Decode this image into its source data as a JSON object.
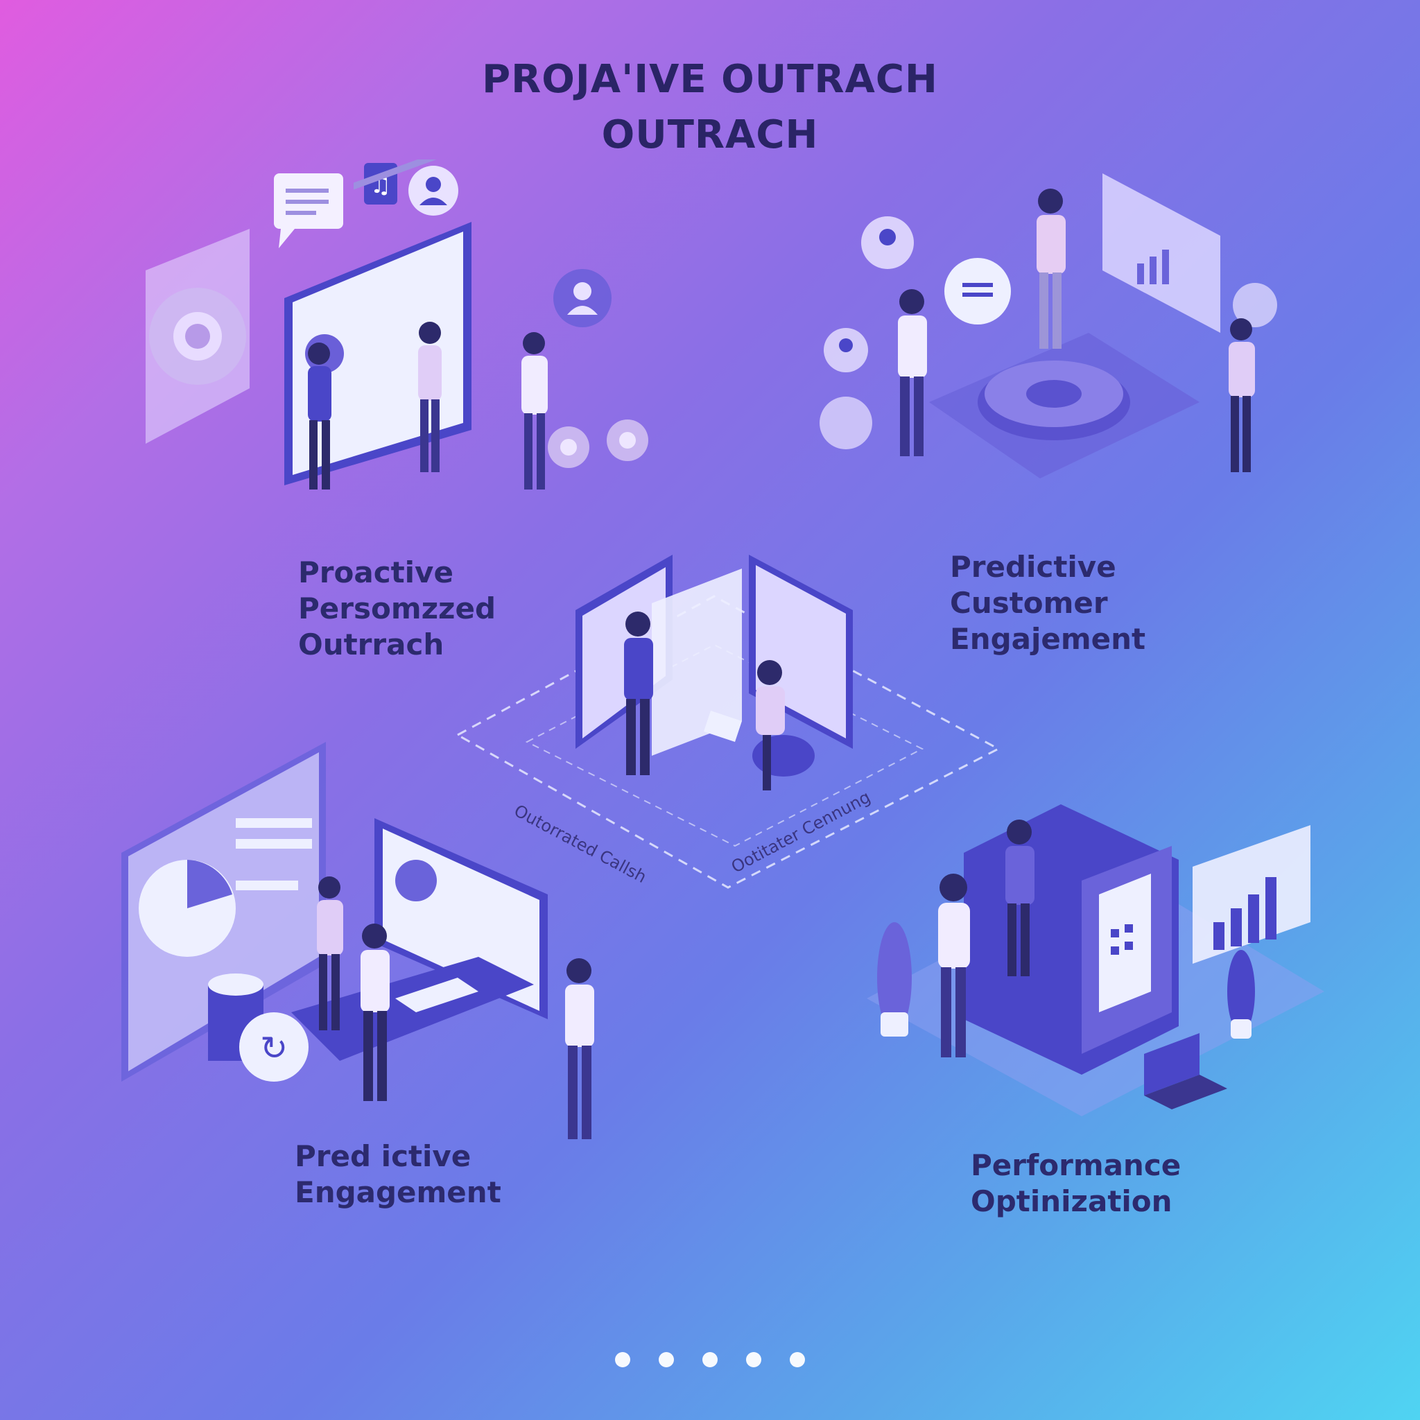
{
  "header": {
    "title_line1": "PROJA'IVE OUTRACH",
    "title_line2": "OUTRACH"
  },
  "sections": {
    "top_left": {
      "line1": "Proactive",
      "line2": "Persomzzed",
      "line3": "Outrrach"
    },
    "top_right": {
      "line1": "Predictive",
      "line2": "Customer",
      "line3": "Engajement"
    },
    "bottom_left": {
      "line1": "Pred ictive",
      "line2": "Engagement"
    },
    "bottom_right": {
      "line1": "Performance",
      "line2": "Optinization"
    }
  },
  "center": {
    "flow_left": "Outorrated Callsh",
    "flow_right": "Ootitater Cennung"
  },
  "pagination": {
    "count": 5
  },
  "colors": {
    "ink": "#2c2a6e",
    "indigo": "#4a46c8",
    "lilac": "#d9c8f5",
    "panel": "#eef0ff"
  },
  "icons": [
    "gear-icon",
    "chat-bubble-icon",
    "music-note-icon",
    "user-avatar-icon",
    "bar-chart-icon",
    "calculator-icon",
    "plant-icon",
    "laptop-icon"
  ]
}
